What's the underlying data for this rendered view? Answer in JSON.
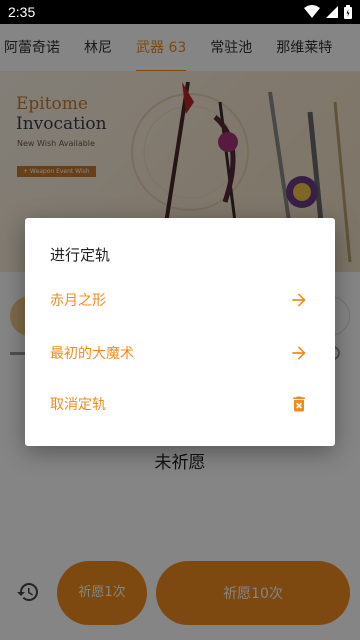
{
  "status_bar": {
    "time": "2:35"
  },
  "tabs": [
    {
      "label": "阿蕾奇诺",
      "active": false
    },
    {
      "label": "林尼",
      "active": false
    },
    {
      "label": "武器 63",
      "active": true
    },
    {
      "label": "常驻池",
      "active": false
    },
    {
      "label": "那维莱特",
      "active": false
    }
  ],
  "banner": {
    "title_line1": "Epitome",
    "title_line2": "Invocation",
    "subtitle": "New Wish Available",
    "tag": "+ Weapon Event Wish"
  },
  "main": {
    "empty_text": "未祈愿"
  },
  "bottom": {
    "wish1_label": "祈愿1次",
    "wish10_label": "祈愿10次"
  },
  "dialog": {
    "title": "进行定轨",
    "items": [
      {
        "label": "赤月之形",
        "icon": "arrow-right-icon"
      },
      {
        "label": "最初的大魔术",
        "icon": "arrow-right-icon"
      },
      {
        "label": "取消定轨",
        "icon": "delete-icon"
      }
    ]
  },
  "colors": {
    "accent": "#f08c1f",
    "scrim": "rgba(0,0,0,0.48)"
  }
}
